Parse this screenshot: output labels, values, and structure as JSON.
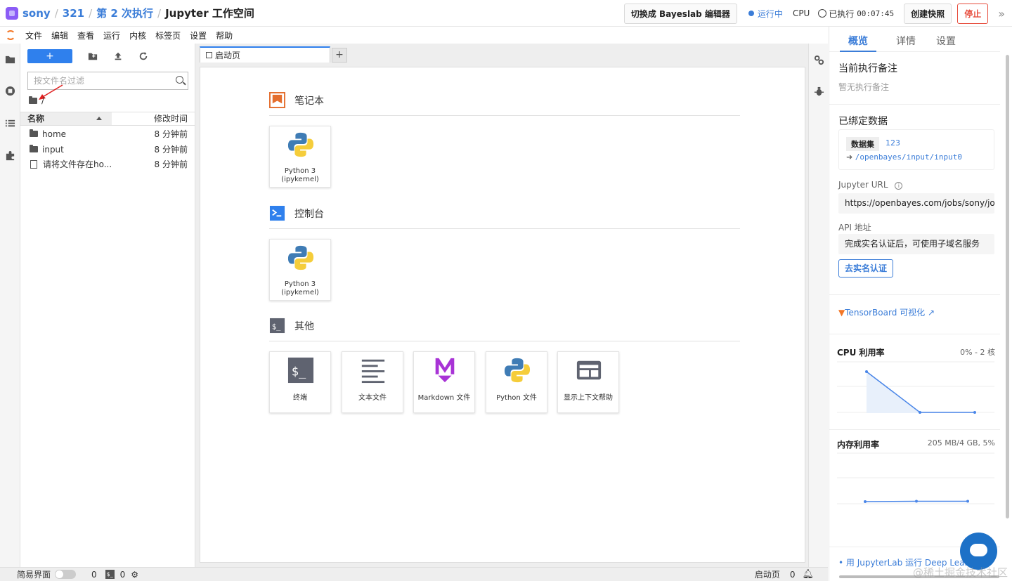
{
  "topbar": {
    "breadcrumb": [
      "sony",
      "321",
      "第 2 次执行",
      "Jupyter 工作空间"
    ],
    "switch_button": "切换成 Bayeslab 编辑器",
    "status": "运行中",
    "cpu_label": "CPU",
    "elapsed_label": "已执行",
    "elapsed_time": "00:07:45",
    "snapshot_button": "创建快照",
    "stop_button": "停止",
    "colors": {
      "accent": "#3b7dd8",
      "stop": "#e74c3c"
    }
  },
  "menu": [
    "文件",
    "编辑",
    "查看",
    "运行",
    "内核",
    "标签页",
    "设置",
    "帮助"
  ],
  "filebrowser": {
    "new_label": "+",
    "filter_placeholder": "按文件名过滤",
    "current_path": "/",
    "col_name": "名称",
    "col_modified": "修改时间",
    "rows": [
      {
        "icon": "folder-icon",
        "name": "home",
        "modified": "8 分钟前"
      },
      {
        "icon": "folder-icon",
        "name": "input",
        "modified": "8 分钟前"
      },
      {
        "icon": "file-icon",
        "name": "请将文件存在ho...",
        "modified": "8 分钟前"
      }
    ]
  },
  "tab": {
    "title": "启动页",
    "add_label": "+"
  },
  "launcher": {
    "notebook_section": "笔记本",
    "console_section": "控制台",
    "other_section": "其他",
    "notebook_card": {
      "line1": "Python 3",
      "line2": "(ipykernel)"
    },
    "console_card": {
      "line1": "Python 3",
      "line2": "(ipykernel)"
    },
    "other_cards": [
      "终端",
      "文本文件",
      "Markdown 文件",
      "Python 文件",
      "显示上下文帮助"
    ]
  },
  "rightpanel": {
    "tabs": [
      "概览",
      "详情",
      "设置"
    ],
    "note_title": "当前执行备注",
    "note_empty": "暂无执行备注",
    "bound_title": "已绑定数据",
    "dataset_tag": "数据集",
    "dataset_id": "123",
    "dataset_path": "/openbayes/input/input0",
    "jupyter_url_label": "Jupyter URL",
    "jupyter_url": "https://openbayes.com/jobs/sony/jo",
    "api_label": "API 地址",
    "api_text": "完成实名认证后，可使用子域名服务",
    "verify_button": "去实名认证",
    "tensorboard_link": "TensorBoard 可视化",
    "cpu_title": "CPU 利用率",
    "cpu_value": "0% - 2 核",
    "mem_title": "内存利用率",
    "mem_value": "205 MB/4 GB, 5%",
    "bottom_link": "用 JupyterLab 运行 Deep Learn"
  },
  "statusbar": {
    "simple_mode": "简易界面",
    "count1": "0",
    "terminal_glyph": "$_",
    "count2": "0",
    "launcher_label": "启动页",
    "notif_count": "0"
  },
  "watermark": "@稀土掘金技术社区"
}
